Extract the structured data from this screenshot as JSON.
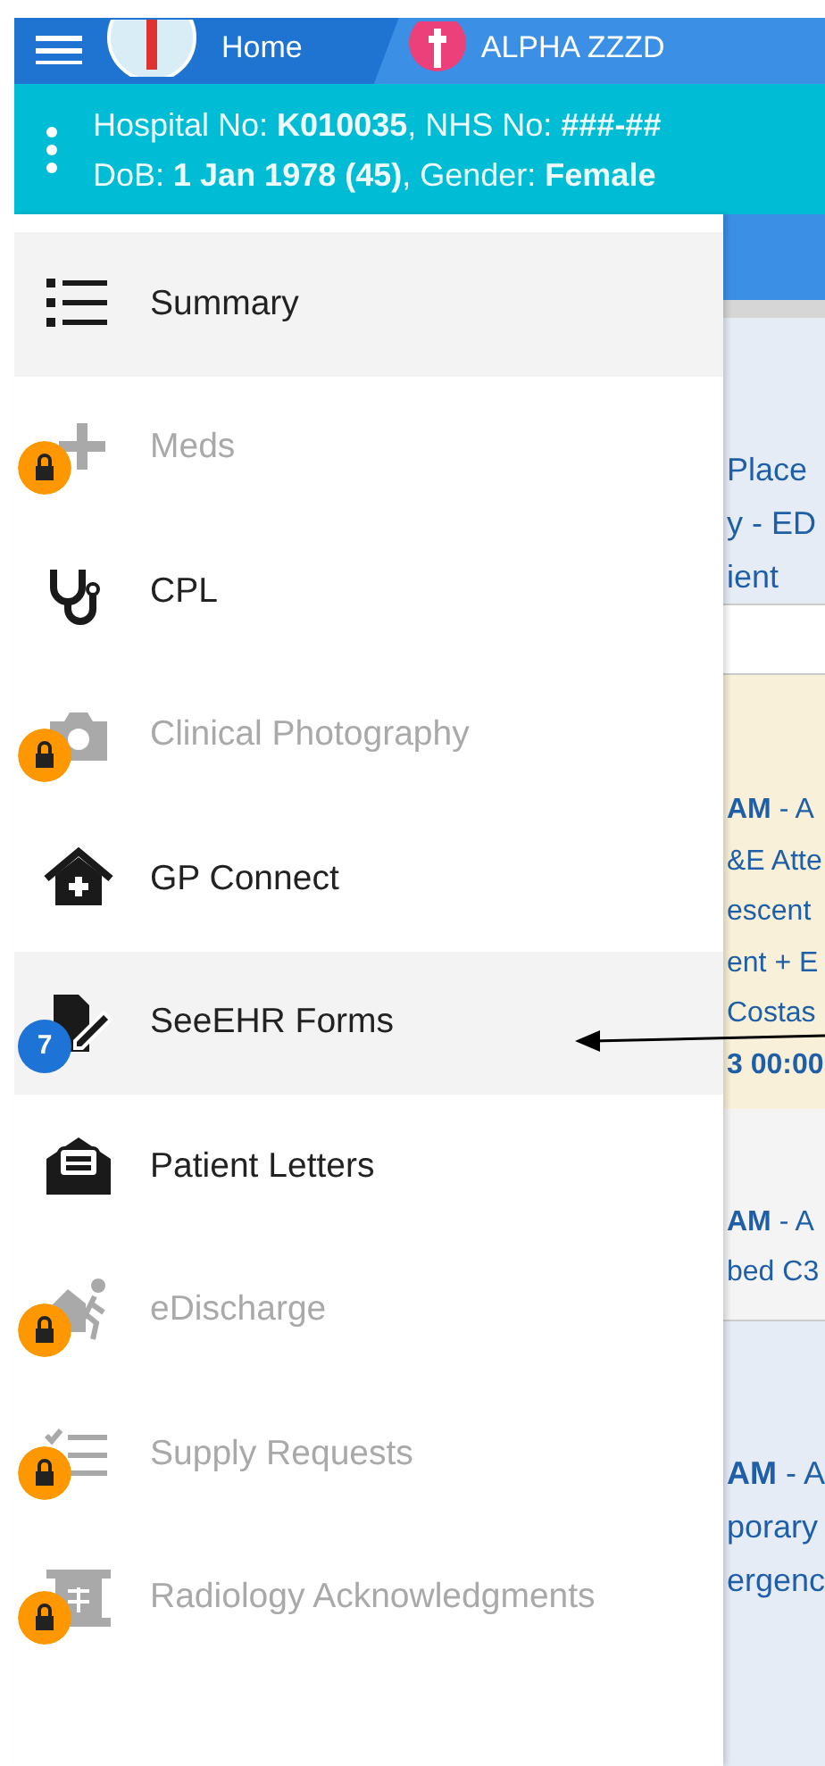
{
  "header": {
    "home_tab": "Home",
    "patient_tab": "ALPHA ZZZD"
  },
  "patient_banner": {
    "line_1": "Hospital No: **K010035**, NHS No: **###-##**",
    "line_2": "DoB: **1 Jan 1978 (45)**, Gender: **Female**"
  },
  "menu": [
    {
      "label": "Summary",
      "kind": "list",
      "selected": true,
      "locked": false
    },
    {
      "label": "Meds",
      "kind": "plus",
      "selected": false,
      "locked": true
    },
    {
      "label": "CPL",
      "kind": "stethoscope",
      "selected": false,
      "locked": false
    },
    {
      "label": "Clinical Photography",
      "kind": "camera",
      "selected": false,
      "locked": true
    },
    {
      "label": "GP Connect",
      "kind": "house",
      "selected": false,
      "locked": false
    },
    {
      "label": "SeeEHR Forms",
      "kind": "form",
      "selected": true,
      "locked": false,
      "badge": "7"
    },
    {
      "label": "Patient Letters",
      "kind": "letter",
      "selected": false,
      "locked": false
    },
    {
      "label": "eDischarge",
      "kind": "walker",
      "selected": false,
      "locked": true
    },
    {
      "label": "Supply Requests",
      "kind": "checklist",
      "selected": false,
      "locked": true
    },
    {
      "label": "Radiology Acknowledgments",
      "kind": "scroll",
      "selected": false,
      "locked": true
    }
  ],
  "background_content": [
    {
      "kind": "bar"
    },
    {
      "kind": "info",
      "lines": [
        "Place",
        "y - ED",
        "ient"
      ]
    },
    {
      "kind": "blank"
    },
    {
      "kind": "warning",
      "lines": [
        "**AM** - A",
        "&E Atte",
        "escent",
        "ent + E",
        "Costas",
        "**3 00:00**"
      ]
    },
    {
      "kind": "plain",
      "lines": [
        "**AM** - A",
        "bed C3"
      ]
    },
    {
      "kind": "info",
      "lines": [
        "**AM** - A",
        "porary",
        "ergenc"
      ]
    }
  ]
}
